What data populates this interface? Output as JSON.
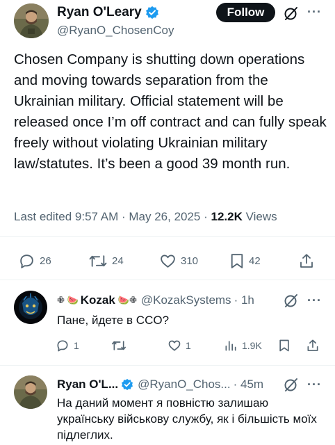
{
  "tweet": {
    "author_name": "Ryan O'Leary",
    "author_handle": "@RyanO_ChosenCoy",
    "follow_label": "Follow",
    "more_label": "···",
    "text": "Chosen Company is shutting down operations and moving towards separation from the Ukrainian military. Official statement will be released once I’m off contract and can fully speak freely without violating Ukrainian military law/statutes. It’s been a good 39 month run.",
    "edited": "Last edited 9:57 AM · May 26, 2025 · ",
    "views_count": "12.2K",
    "views_label": " Views",
    "stats": {
      "replies": "26",
      "reposts": "24",
      "likes": "310",
      "bookmarks": "42"
    }
  },
  "replies": [
    {
      "name": "Kozak",
      "name_prefix": "✙ 🍉",
      "name_suffix": "🍉✙",
      "handle": "@KozakSystems",
      "time": "· 1h",
      "text": "Пане, йдете в СCO?",
      "stats": {
        "replies": "1",
        "reposts": "",
        "likes": "1",
        "views": "1.9K"
      }
    },
    {
      "name": "Ryan O'L...",
      "handle": "@RyanO_Chos...",
      "time": "· 45m",
      "text": "На даний момент я повністю залишаю українську військову службу, як і більшість моїх підлеглих."
    }
  ],
  "colors": {
    "accent": "#1d9bf0",
    "text": "#0f1419",
    "muted": "#536471",
    "divider": "#eff3f4"
  }
}
